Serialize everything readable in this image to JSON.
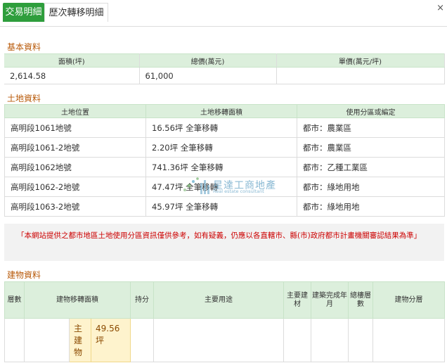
{
  "tabs": [
    {
      "label": "交易明細",
      "active": true
    },
    {
      "label": "歷次轉移明細",
      "active": false
    }
  ],
  "close_icon": "×",
  "basic": {
    "title": "基本資料",
    "headers": [
      "面積(坪)",
      "總價(萬元)",
      "單價(萬元/坪)"
    ],
    "values": [
      "2,614.58",
      "61,000",
      ""
    ]
  },
  "land": {
    "title": "土地資料",
    "headers": [
      "土地位置",
      "土地移轉面積",
      "使用分區或編定"
    ],
    "rows": [
      [
        "高明段1061地號",
        "16.56坪 全筆移轉",
        "都市：農業區"
      ],
      [
        "高明段1061-2地號",
        "2.20坪 全筆移轉",
        "都市：農業區"
      ],
      [
        "高明段1062地號",
        "741.36坪 全筆移轉",
        "都市：乙種工業區"
      ],
      [
        "高明段1062-2地號",
        "47.47坪 全筆移轉",
        "都市：綠地用地"
      ],
      [
        "高明段1063-2地號",
        "45.97坪 全筆移轉",
        "都市：綠地用地"
      ]
    ]
  },
  "notice": "「本網站提供之都市地區土地使用分區資訊僅供參考，如有疑義，仍應以各直轄市、縣(市)政府都市計畫機關審認結果為準」",
  "building": {
    "title": "建物資料",
    "headers": {
      "floor": "層數",
      "area": "建物移轉面積",
      "share": "持分",
      "use": "主要用途",
      "material": "主要建材",
      "year": "建築完成年月",
      "total_floors": "總樓層數",
      "division": "建物分層"
    },
    "main_label": "主建物",
    "main_value": "49.56坪"
  },
  "watermark": {
    "text": "星達工商地產",
    "sub": "Real estate consultant"
  }
}
